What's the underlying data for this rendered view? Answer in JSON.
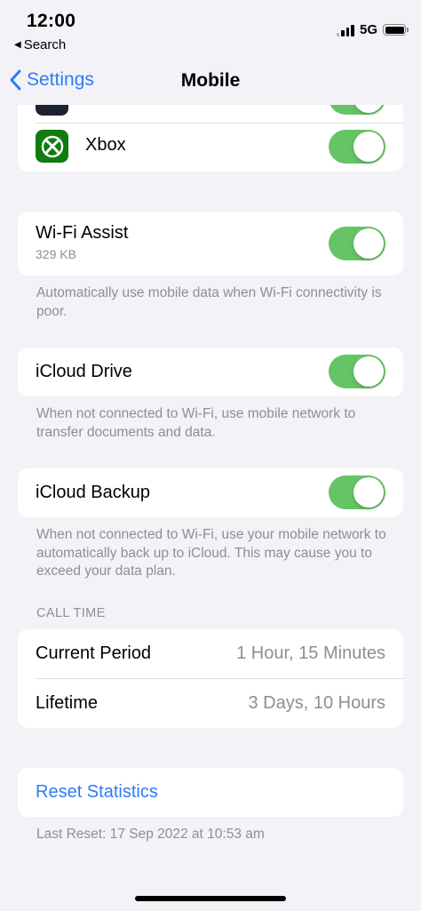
{
  "status_bar": {
    "time": "12:00",
    "back_app": "Search",
    "network": "5G"
  },
  "nav": {
    "back_label": "Settings",
    "title": "Mobile"
  },
  "apps": [
    {
      "name": "",
      "icon": "partially-hidden-app-icon",
      "enabled": true
    },
    {
      "name": "Xbox",
      "icon": "xbox-icon",
      "enabled": true
    }
  ],
  "wifi_assist": {
    "label": "Wi-Fi Assist",
    "size": "329 KB",
    "enabled": true,
    "footnote": "Automatically use mobile data when Wi-Fi connectivity is poor."
  },
  "icloud_drive": {
    "label": "iCloud Drive",
    "enabled": true,
    "footnote": "When not connected to Wi-Fi, use mobile network to transfer documents and data."
  },
  "icloud_backup": {
    "label": "iCloud Backup",
    "enabled": true,
    "footnote": "When not connected to Wi-Fi, use your mobile network to automatically back up to iCloud. This may cause you to exceed your data plan."
  },
  "call_time": {
    "header": "CALL TIME",
    "rows": [
      {
        "label": "Current Period",
        "value": "1 Hour, 15 Minutes"
      },
      {
        "label": "Lifetime",
        "value": "3 Days, 10 Hours"
      }
    ]
  },
  "reset": {
    "label": "Reset Statistics",
    "last_reset": "Last Reset: 17 Sep 2022 at 10:53 am"
  },
  "colors": {
    "accent": "#2d7cf6",
    "toggle_on": "#65c466",
    "background": "#f2f2f7",
    "xbox_green": "#107c10"
  }
}
